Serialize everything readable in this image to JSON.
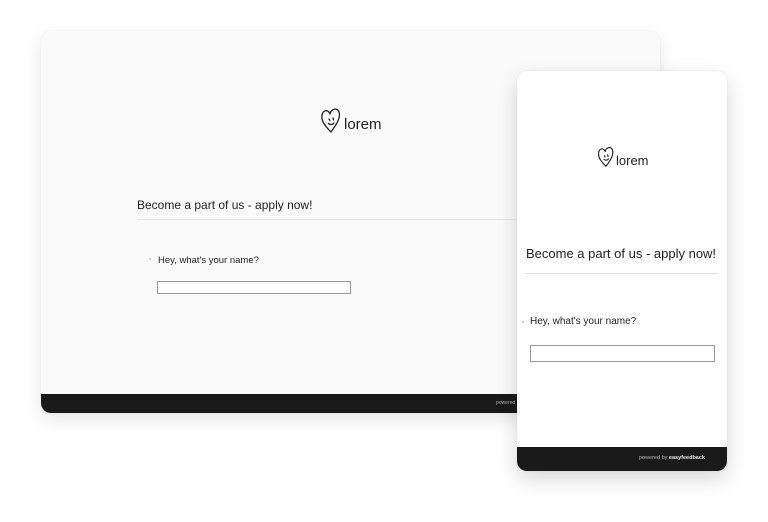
{
  "brand": {
    "name": "lorem",
    "logo_icon": "heart-face-icon"
  },
  "form": {
    "title": "Become a part of us - apply now!",
    "question": "Hey, what's your name?",
    "answer_value": "",
    "answer_placeholder": ""
  },
  "footer": {
    "powered_prefix": "powered by",
    "powered_brand": "easyfeedback",
    "desktop_truncated": "powered"
  },
  "colors": {
    "footer_bg": "#1a1a1a",
    "page_bg": "#fafafa",
    "text": "#222222"
  }
}
